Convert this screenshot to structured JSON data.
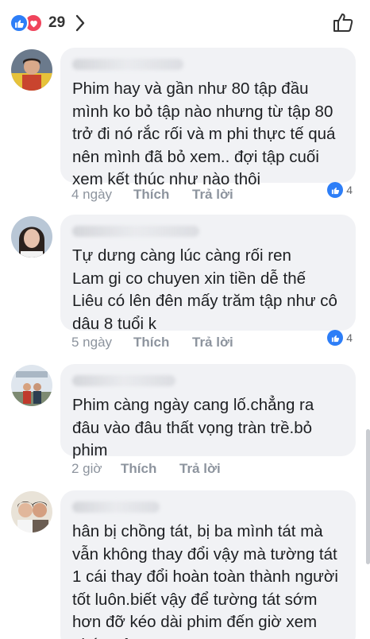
{
  "header": {
    "reaction_count": "29",
    "reaction_icons": [
      "like-icon",
      "love-icon"
    ],
    "like_icon": "thumbs-up-outline-icon",
    "chevron_icon": "chevron-right-icon"
  },
  "colors": {
    "like_blue": "#2d7ef7",
    "love_red": "#f0445c",
    "bubble_bg": "#f1f2f5",
    "meta_gray": "#8d949e"
  },
  "comments": [
    {
      "text": "Phim hay và gần như 80 tập đầu\nmình ko bỏ tập nào nhưng từ tập 80\ntrở đi nó rắc rối và m phi thực tế quá\nnên mình đã bỏ xem.. đợi tập cuối\nxem kết thúc như nào thôi",
      "age": "4 ngày",
      "like_label": "Thích",
      "reply_label": "Trả lời",
      "likes": "4"
    },
    {
      "text": "Tự dưng càng lúc càng rối ren\nLam gi co chuyen xin tiền dễ thế\nLiêu có lên đên mấy trăm tập như cô\ndâu 8 tuổi k",
      "age": "5 ngày",
      "like_label": "Thích",
      "reply_label": "Trả lời",
      "likes": "4"
    },
    {
      "text": "Phim càng ngày cang lố.chẳng ra\nđâu vào đâu thất vọng tràn trề.bỏ\nphim",
      "age": "2 giờ",
      "like_label": "Thích",
      "reply_label": "Trả lời"
    },
    {
      "text": "hân bị chồng tát, bị ba mình tát mà\nvẫn không thay đổi vậy mà tường tát\n1 cái thay đổi hoàn toàn thành người\ntốt luôn.biết vậy để tường tát sớm\nhơn đỡ kéo dài phim đến giờ xem\nphát mệt"
    }
  ]
}
